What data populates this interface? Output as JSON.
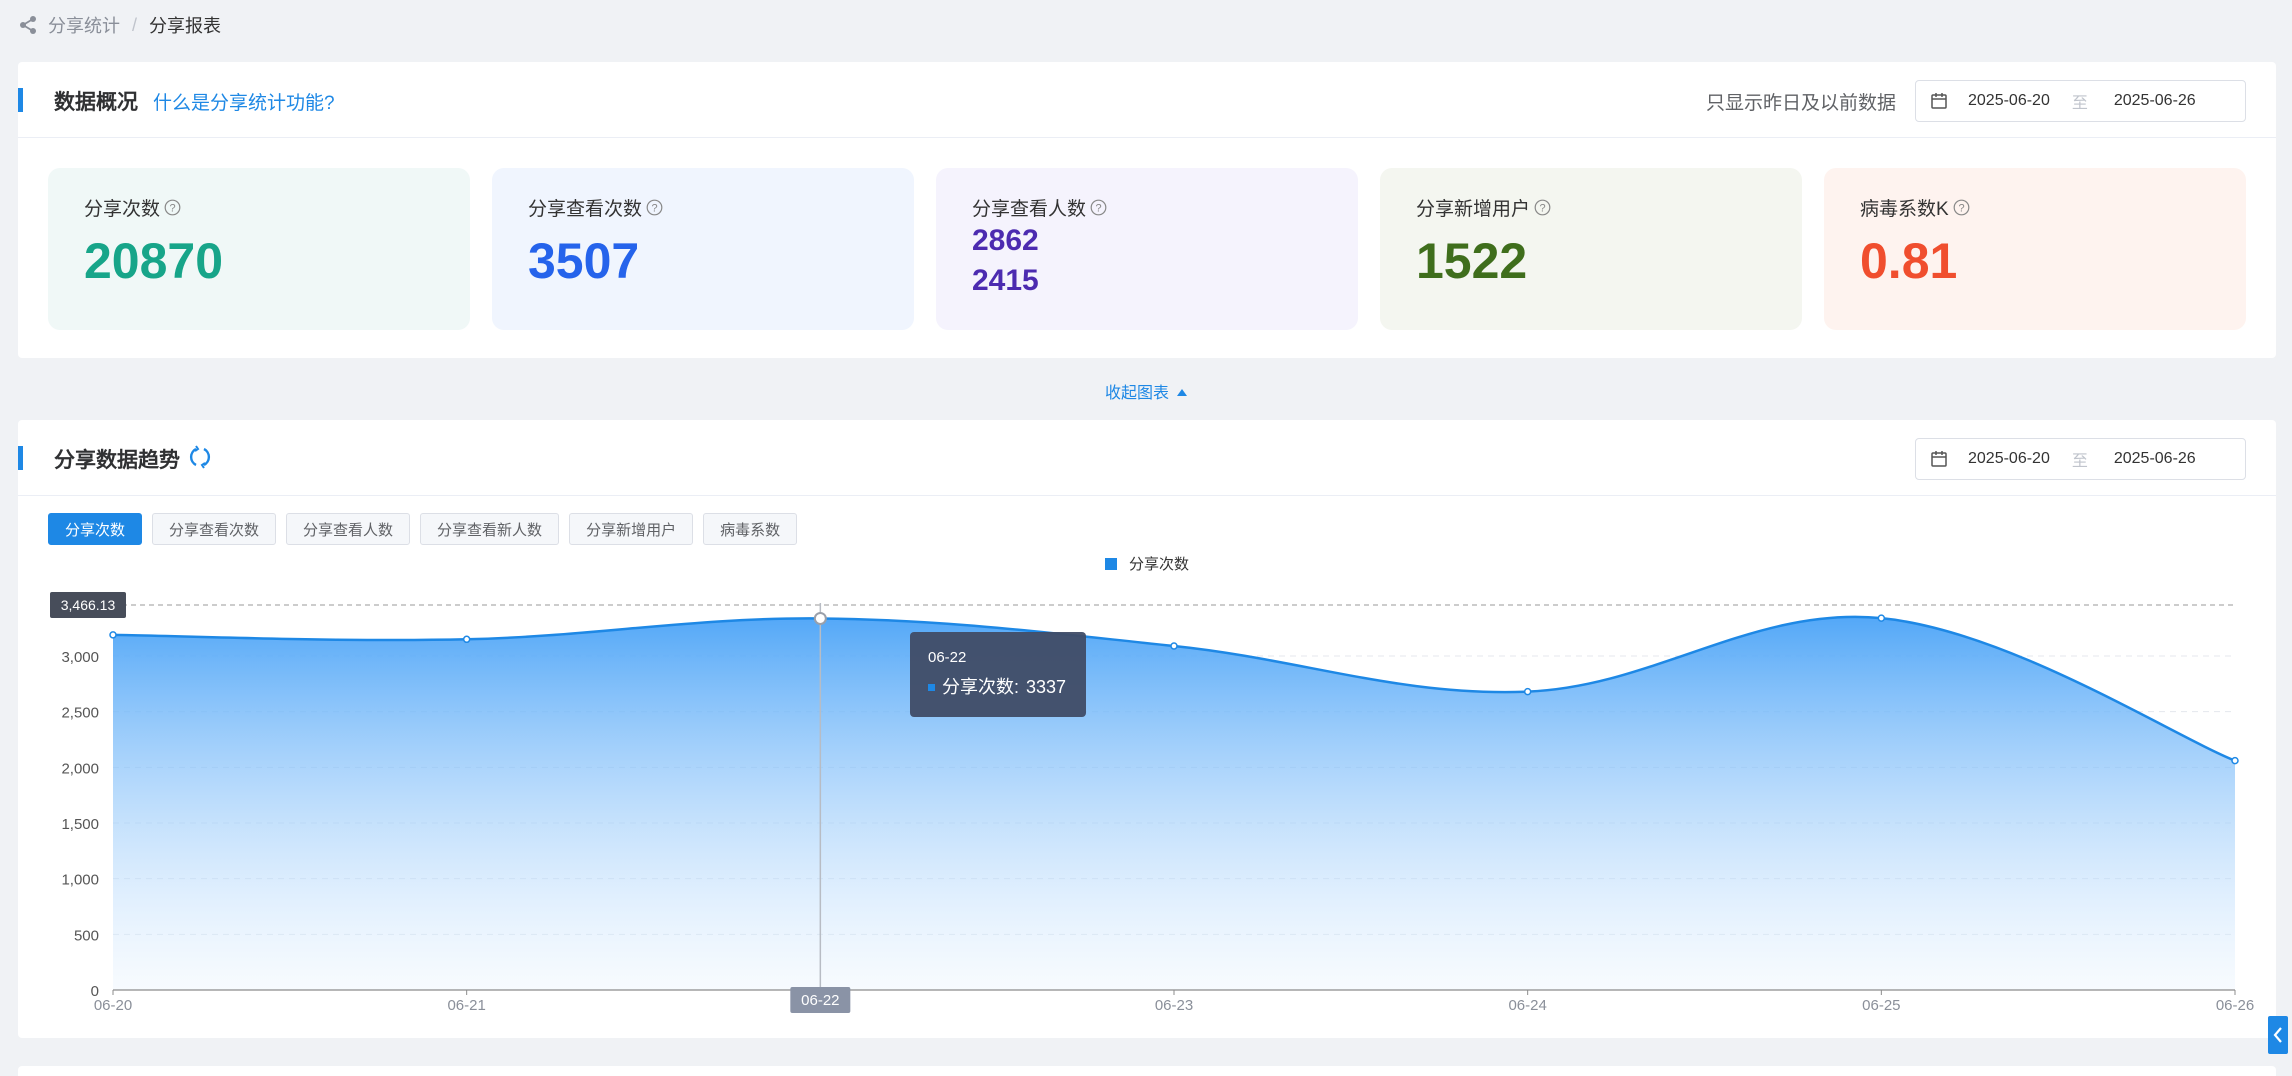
{
  "breadcrumb": {
    "parent": "分享统计",
    "separator": "/",
    "current": "分享报表"
  },
  "overview": {
    "title": "数据概况",
    "help_link": "什么是分享统计功能?",
    "note": "只显示昨日及以前数据",
    "date_range": {
      "start": "2025-06-20",
      "separator": "至",
      "end": "2025-06-26"
    },
    "kpis": [
      {
        "label": "分享次数",
        "value": "20870",
        "color": "#17a589",
        "bg": "#f0f8f7"
      },
      {
        "label": "分享查看次数",
        "value": "3507",
        "color": "#2563eb",
        "bg": "#f0f5fe"
      },
      {
        "label": "分享查看人数",
        "value": "2862",
        "value2": "2415",
        "color": "#4c2bb0",
        "bg": "#f5f3fd"
      },
      {
        "label": "分享新增用户",
        "value": "1522",
        "color": "#3f6e1c",
        "bg": "#f4f6f0"
      },
      {
        "label": "病毒系数K",
        "value": "0.81",
        "color": "#f04e2e",
        "bg": "#fef3ef"
      }
    ]
  },
  "collapse_label": "收起图表",
  "trend": {
    "title": "分享数据趋势",
    "date_range": {
      "start": "2025-06-20",
      "separator": "至",
      "end": "2025-06-26"
    },
    "tabs": [
      "分享次数",
      "分享查看次数",
      "分享查看人数",
      "分享查看新人数",
      "分享新增用户",
      "病毒系数"
    ],
    "active_tab": 0
  },
  "chart_data": {
    "type": "area",
    "legend_position": "top-center",
    "x": [
      "06-20",
      "06-21",
      "06-22",
      "06-23",
      "06-24",
      "06-25",
      "06-26"
    ],
    "series": [
      {
        "name": "分享次数",
        "values": [
          3190,
          3150,
          3337,
          3090,
          2680,
          3340,
          2060
        ],
        "color": "#1e88e5"
      }
    ],
    "ylim": [
      0,
      3500
    ],
    "yticks": [
      0,
      500,
      1000,
      1500,
      2000,
      2500,
      3000
    ],
    "ytick_labels": [
      "0",
      "500",
      "1,000",
      "1,500",
      "2,000",
      "2,500",
      "3,000"
    ],
    "grid": true,
    "axis_pointer": {
      "x": "06-22",
      "y_label": "3,466.13"
    },
    "tooltip": {
      "title": "06-22",
      "series": "分享次数",
      "value": "3337"
    }
  }
}
